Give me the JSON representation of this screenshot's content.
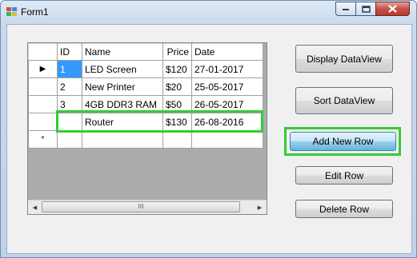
{
  "window": {
    "title": "Form1"
  },
  "grid": {
    "columns": [
      "ID",
      "Name",
      "Price",
      "Date"
    ],
    "rows": [
      {
        "indicator": "▶",
        "id": "1",
        "name": "LED Screen",
        "price": "$120",
        "date": "27-01-2017"
      },
      {
        "indicator": "",
        "id": "2",
        "name": "New Printer",
        "price": "$20",
        "date": "25-05-2017"
      },
      {
        "indicator": "",
        "id": "3",
        "name": "4GB DDR3 RAM",
        "price": "$50",
        "date": "26-05-2017"
      },
      {
        "indicator": "",
        "id": "",
        "name": "Router",
        "price": "$130",
        "date": "26-08-2016"
      },
      {
        "indicator": "*",
        "id": "",
        "name": "",
        "price": "",
        "date": ""
      }
    ],
    "scroll_thumb_glyph": "III"
  },
  "buttons": {
    "display": "Display DataView",
    "sort": "Sort DataView",
    "add": "Add New Row",
    "edit": "Edit Row",
    "delete": "Delete Row"
  },
  "colors": {
    "highlight": "#33cc33",
    "selection": "#3399ff"
  }
}
